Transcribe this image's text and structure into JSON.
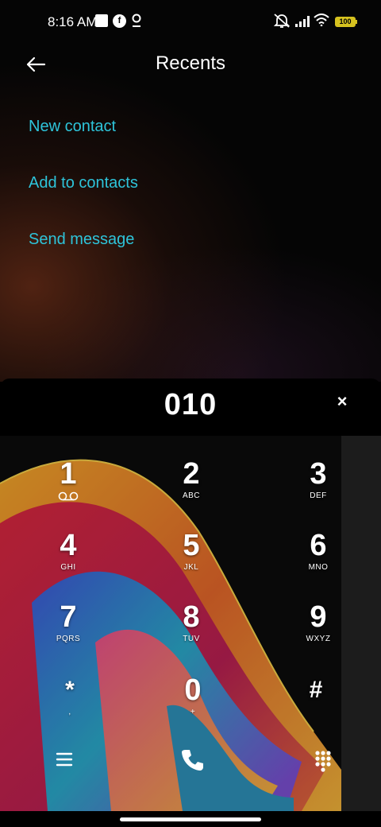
{
  "status_bar": {
    "time": "8:16 AM",
    "left_icons": [
      "square-icon",
      "f-circle-icon",
      "location-icon"
    ],
    "right_icons": [
      "bell-off-icon",
      "signal-icon",
      "wifi-icon",
      "battery-icon"
    ],
    "battery": "100",
    "battery_color": "#d6c21f"
  },
  "header": {
    "title": "Recents",
    "back_icon": "back-arrow-icon"
  },
  "menu": {
    "items": [
      {
        "label": "New contact"
      },
      {
        "label": "Add to contacts"
      },
      {
        "label": "Send message"
      }
    ],
    "link_color": "#2ec4da"
  },
  "dialer": {
    "number": "010",
    "clear_label": "×",
    "keys": [
      {
        "digit": "1",
        "letters": ""
      },
      {
        "digit": "2",
        "letters": "ABC"
      },
      {
        "digit": "3",
        "letters": "DEF"
      },
      {
        "digit": "4",
        "letters": "GHI"
      },
      {
        "digit": "5",
        "letters": "JKL"
      },
      {
        "digit": "6",
        "letters": "MNO"
      },
      {
        "digit": "7",
        "letters": "PQRS"
      },
      {
        "digit": "8",
        "letters": "TUV"
      },
      {
        "digit": "9",
        "letters": "WXYZ"
      },
      {
        "digit": "*",
        "letters": ","
      },
      {
        "digit": "0",
        "letters": "+"
      },
      {
        "digit": "#",
        "letters": ""
      }
    ],
    "bottom_icons": [
      "menu-icon",
      "phone-icon",
      "keypad-icon"
    ]
  }
}
